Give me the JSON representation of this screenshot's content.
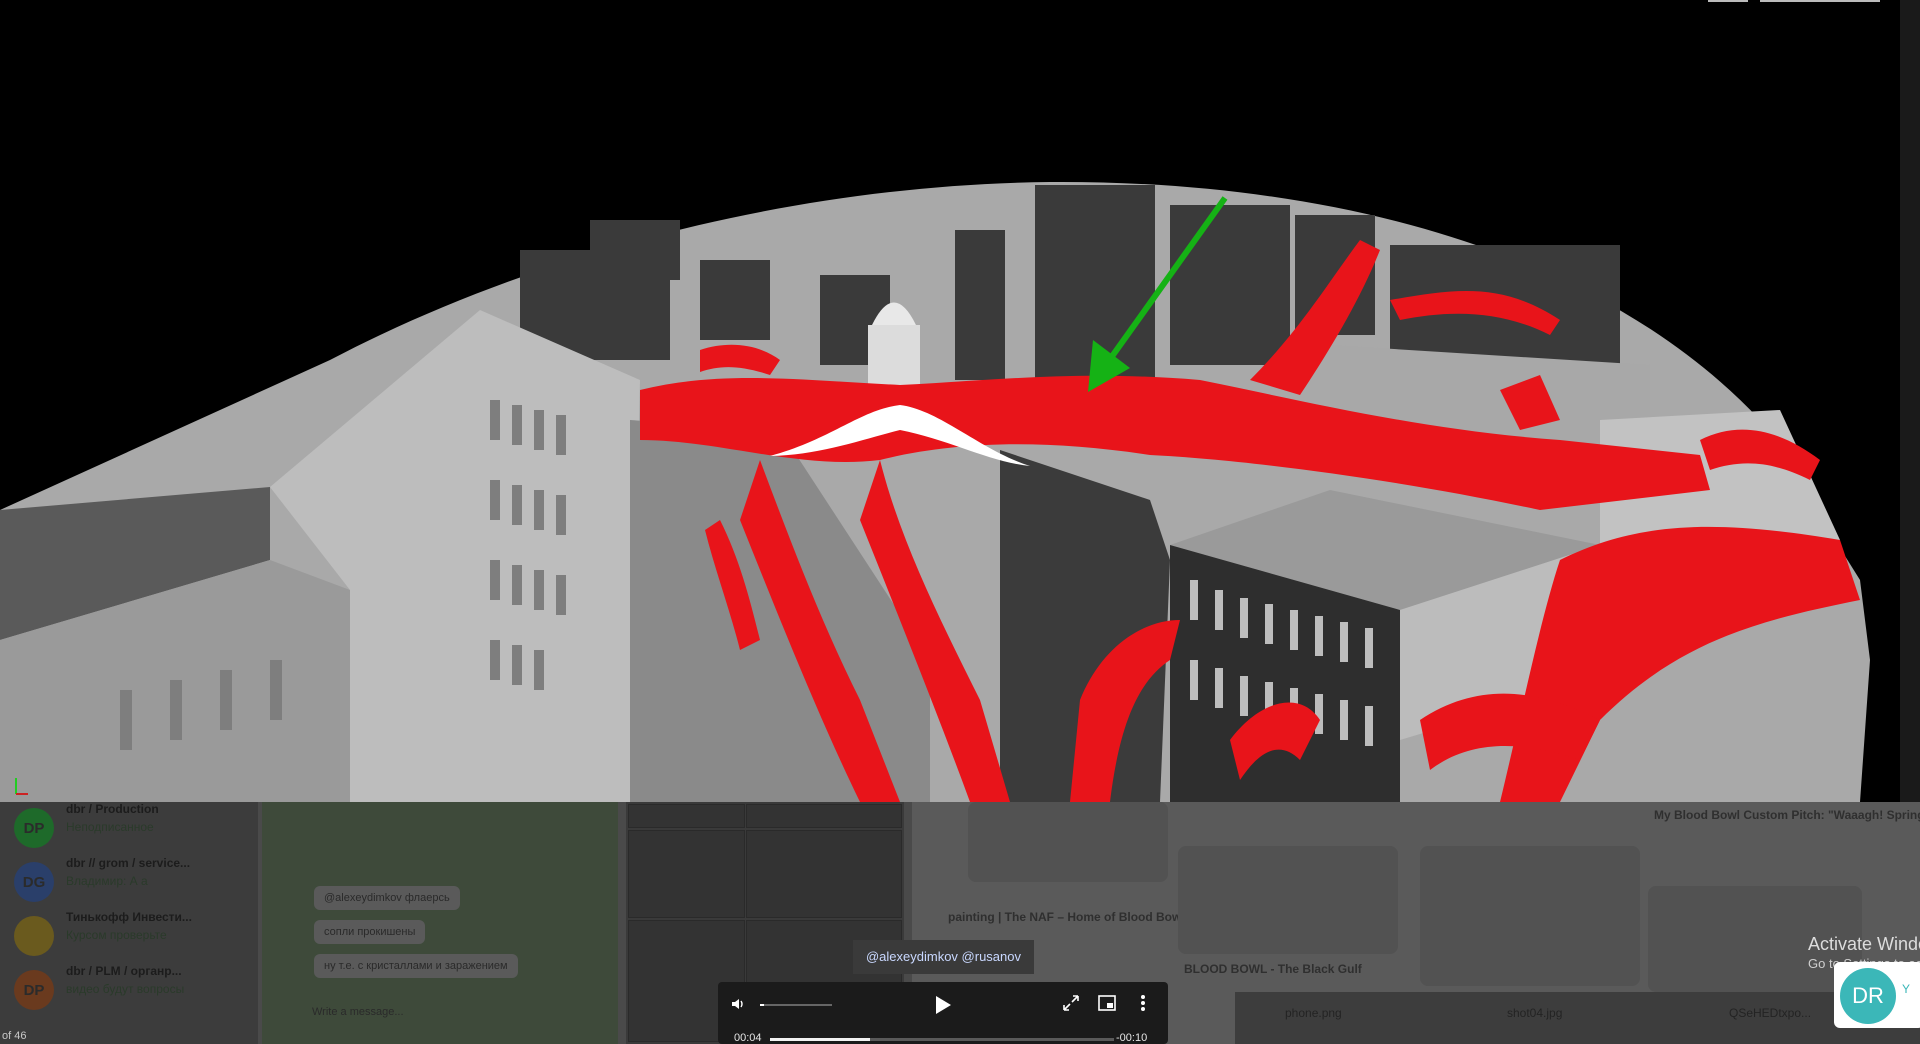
{
  "video": {
    "caption": "@alexeydimkov @rusanov",
    "time_current": "00:04",
    "time_remaining": "-00:10",
    "progress": 0.29,
    "volume": 0.05
  },
  "background_app": {
    "chats": [
      {
        "avatar": "DP",
        "avatar_color": "#1e6a2a",
        "name": "dbr / Production",
        "preview": "Неподписанное"
      },
      {
        "avatar": "DG",
        "avatar_color": "#2a3f6a",
        "name": "dbr // grom / service...",
        "preview": "Владимир: А а"
      },
      {
        "avatar": "",
        "avatar_color": "#6a5a1e",
        "name": "Тинькофф Инвести...",
        "preview": "Курсом проверьте"
      },
      {
        "avatar": "DP",
        "avatar_color": "#6a3a1e",
        "name": "dbr / PLM / органр...",
        "preview": "видео будут вопросы"
      }
    ],
    "bubbles": [
      "@alexeydimkov флаерсь",
      "сопли прокишены",
      "ну т.е. с кристаллами и заражением"
    ],
    "message_placeholder": "Write a message...",
    "shop": {
      "card1_title": "painting | The NAF – Home of Blood Bowl",
      "card2_title": "BLOOD BOWL - The Black Gulf",
      "card3_title": "My Blood Bowl Custom Pitch: \"Waaagh! Springs Stadium\" - part..."
    },
    "downloads": [
      "phone.png",
      "shot04.jpg",
      "QSeHEDtxpo..."
    ],
    "status_left": "of 46"
  },
  "windows_watermark": {
    "line1": "Activate Windows",
    "line2": "Go to Settings to activate Windows."
  },
  "notification": {
    "avatar": "DR",
    "text": "Y"
  }
}
